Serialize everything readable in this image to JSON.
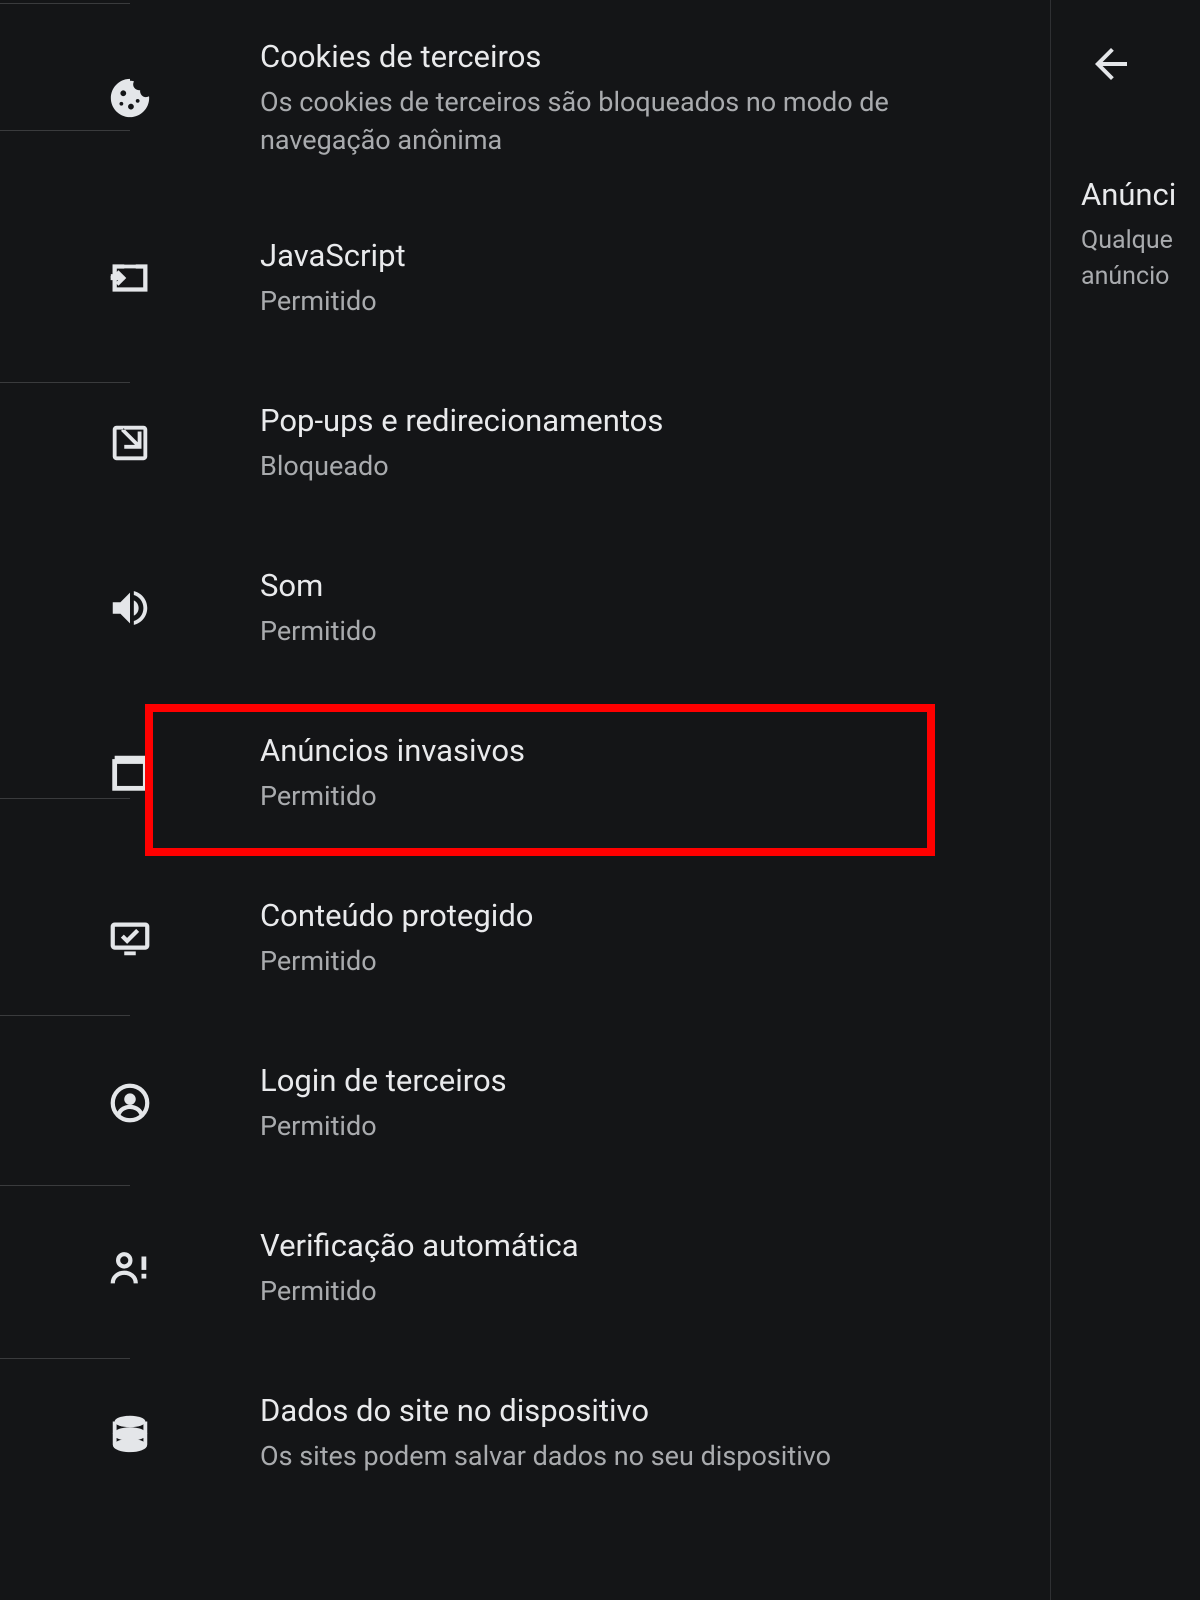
{
  "settings": {
    "items": [
      {
        "icon": "cookie",
        "title": "Cookies de terceiros",
        "subtitle": "Os cookies de terceiros são bloqueados no modo de navegação anônima"
      },
      {
        "icon": "javascript",
        "title": "JavaScript",
        "subtitle": "Permitido"
      },
      {
        "icon": "popup",
        "title": "Pop-ups e redirecionamentos",
        "subtitle": "Bloqueado"
      },
      {
        "icon": "sound",
        "title": "Som",
        "subtitle": "Permitido"
      },
      {
        "icon": "ads",
        "title": "Anúncios invasivos",
        "subtitle": "Permitido",
        "highlighted": true
      },
      {
        "icon": "protected",
        "title": "Conteúdo protegido",
        "subtitle": "Permitido"
      },
      {
        "icon": "thirdparty-login",
        "title": "Login de terceiros",
        "subtitle": "Permitido"
      },
      {
        "icon": "auto-verify",
        "title": "Verificação automática",
        "subtitle": "Permitido"
      },
      {
        "icon": "site-data",
        "title": "Dados do site no dispositivo",
        "subtitle": "Os sites podem salvar dados no seu dispositivo"
      }
    ]
  },
  "right": {
    "title": "Anúnci",
    "line1": "Qualque",
    "line2": "anúncio"
  }
}
